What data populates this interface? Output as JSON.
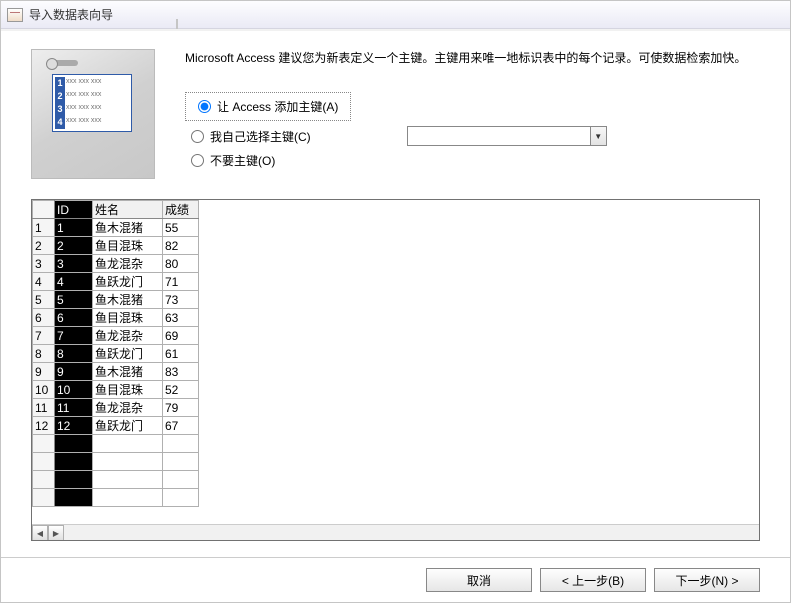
{
  "window": {
    "title": "导入数据表向导"
  },
  "info_text": "Microsoft Access 建议您为新表定义一个主键。主键用来唯一地标识表中的每个记录。可使数据检索加快。",
  "pk_options": {
    "auto": "让 Access 添加主键(A)",
    "choose": "我自己选择主键(C)",
    "none": "不要主键(O)",
    "selected": "auto",
    "combo_value": ""
  },
  "table": {
    "columns": [
      "ID",
      "姓名",
      "成绩"
    ],
    "rows": [
      {
        "n": 1,
        "id": "1",
        "name": "鱼木混猪",
        "score": "55"
      },
      {
        "n": 2,
        "id": "2",
        "name": "鱼目混珠",
        "score": "82"
      },
      {
        "n": 3,
        "id": "3",
        "name": "鱼龙混杂",
        "score": "80"
      },
      {
        "n": 4,
        "id": "4",
        "name": "鱼跃龙门",
        "score": "71"
      },
      {
        "n": 5,
        "id": "5",
        "name": "鱼木混猪",
        "score": "73"
      },
      {
        "n": 6,
        "id": "6",
        "name": "鱼目混珠",
        "score": "63"
      },
      {
        "n": 7,
        "id": "7",
        "name": "鱼龙混杂",
        "score": "69"
      },
      {
        "n": 8,
        "id": "8",
        "name": "鱼跃龙门",
        "score": "61"
      },
      {
        "n": 9,
        "id": "9",
        "name": "鱼木混猪",
        "score": "83"
      },
      {
        "n": 10,
        "id": "10",
        "name": "鱼目混珠",
        "score": "52"
      },
      {
        "n": 11,
        "id": "11",
        "name": "鱼龙混杂",
        "score": "79"
      },
      {
        "n": 12,
        "id": "12",
        "name": "鱼跃龙门",
        "score": "67"
      }
    ]
  },
  "buttons": {
    "cancel": "取消",
    "back": "< 上一步(B)",
    "next": "下一步(N) >"
  }
}
